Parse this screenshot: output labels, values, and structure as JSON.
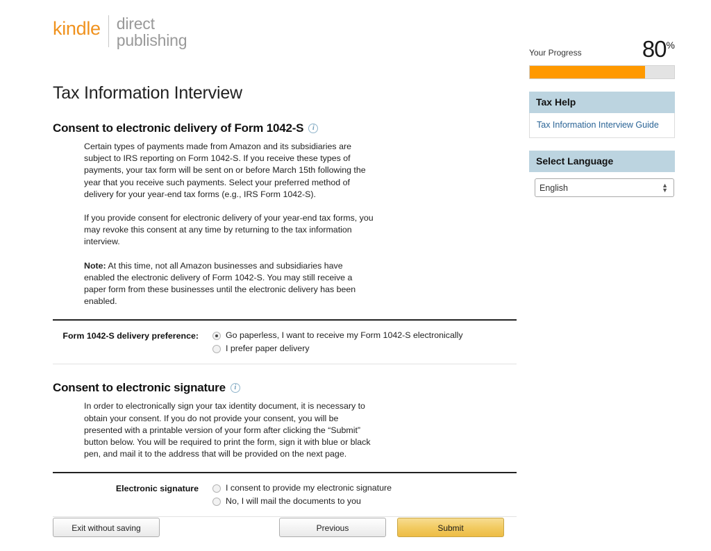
{
  "logo": {
    "brand": "kindle",
    "line1": "direct",
    "line2": "publishing"
  },
  "rail": {
    "progress_label": "Your Progress",
    "progress_value": "80",
    "progress_sign": "%",
    "progress_percent": 80,
    "tax_help": {
      "heading": "Tax Help",
      "link": "Tax Information Interview Guide"
    },
    "language": {
      "heading": "Select Language",
      "selected": "English",
      "options": [
        "English"
      ]
    }
  },
  "main": {
    "page_title": "Tax Information Interview",
    "sections": [
      {
        "title": "Consent to electronic delivery of Form 1042-S",
        "paragraphs": [
          "Certain types of payments made from Amazon and its subsidiaries are subject to IRS reporting on Form 1042-S. If you receive these types of payments, your tax form will be sent on or before March 15th following the year that you receive such payments. Select your preferred method of delivery for your year-end tax forms (e.g., IRS Form 1042-S).",
          "If you provide consent for electronic delivery of your year-end tax forms, you may revoke this consent at any time by returning to the tax information interview.",
          "Note: At this time, not all Amazon businesses and subsidiaries have enabled the electronic delivery of Form 1042-S. You may still receive a paper form from these businesses until the electronic delivery has been enabled."
        ],
        "note_prefix": "Note:",
        "field_label": "Form 1042-S delivery preference:",
        "options": [
          {
            "label": "Go paperless, I want to receive my Form 1042-S electronically",
            "checked": true
          },
          {
            "label": "I prefer paper delivery",
            "checked": false
          }
        ]
      },
      {
        "title": "Consent to electronic signature",
        "paragraphs": [
          "In order to electronically sign your tax identity document, it is necessary to obtain your consent. If you do not provide your consent, you will be presented with a printable version of your form after clicking the “Submit” button below. You will be required to print the form, sign it with blue or black pen, and mail it to the address that will be provided on the next page."
        ],
        "field_label": "Electronic signature",
        "options": [
          {
            "label": "I consent to provide my electronic signature",
            "checked": false
          },
          {
            "label": "No, I will mail the documents to you",
            "checked": false
          }
        ]
      }
    ]
  },
  "footer": {
    "exit_label": "Exit without saving",
    "previous_label": "Previous",
    "submit_label": "Submit"
  },
  "colors": {
    "accent_orange": "#ff9900",
    "brand_orange": "#f0921e",
    "panel_header": "#bcd4e0",
    "link_blue": "#2a6496",
    "submit_gold": "#f2cb62"
  },
  "icons": {
    "info": "i",
    "select_up": "▲",
    "select_down": "▼"
  }
}
